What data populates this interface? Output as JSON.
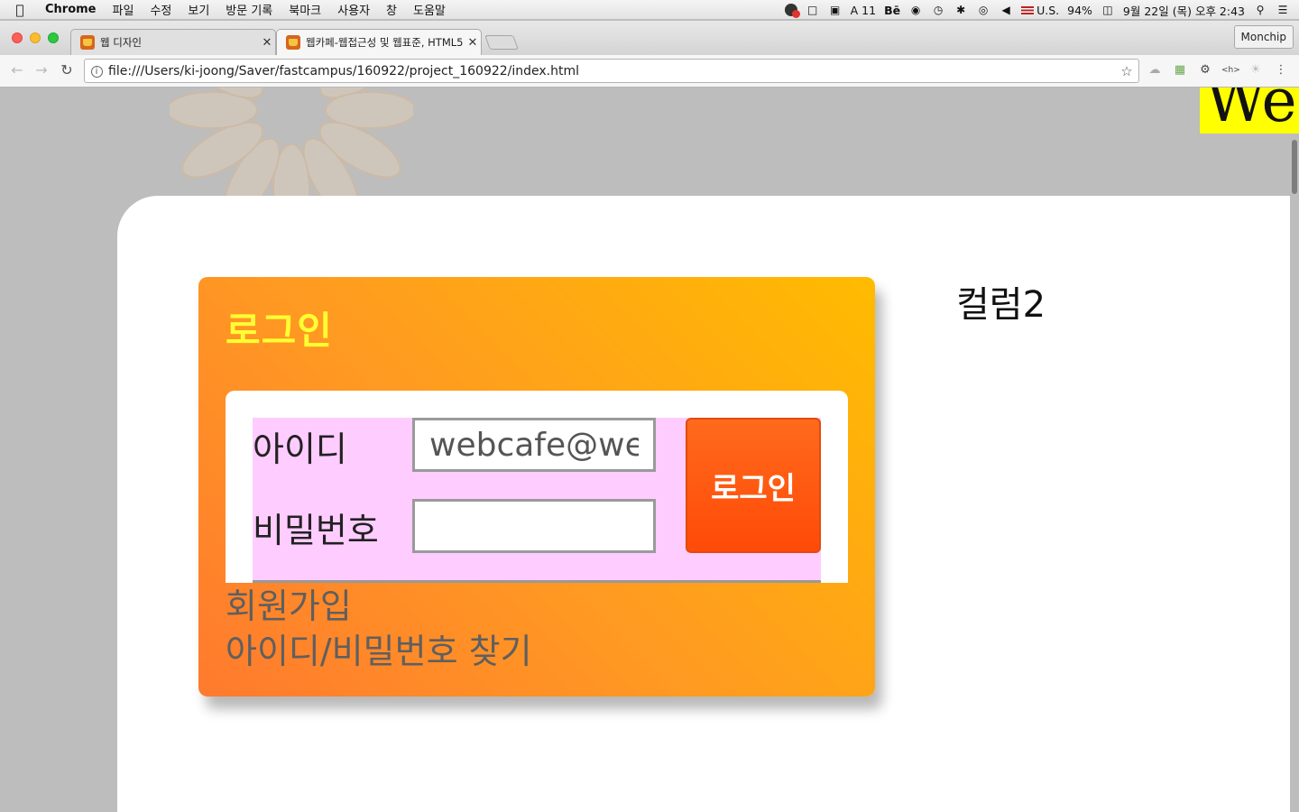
{
  "menubar": {
    "app_name": "Chrome",
    "items": [
      "파일",
      "수정",
      "보기",
      "방문 기록",
      "북마크",
      "사용자",
      "창",
      "도움말"
    ],
    "status": {
      "badge_count": "11",
      "behance": "Bē",
      "input_source": "U.S.",
      "battery": "94%",
      "datetime": "9월 22일 (목) 오후 2:43"
    }
  },
  "tabs": [
    {
      "title": "웹 디자인",
      "active": false
    },
    {
      "title": "웹카페-웹접근성 및 웹표준, HTML5",
      "active": true
    }
  ],
  "profile_name": "Monchip",
  "address_bar": {
    "url": "file:///Users/ki-joong/Saver/fastcampus/160922/project_160922/index.html"
  },
  "page": {
    "corner_logo_text": "We",
    "login": {
      "title": "로그인",
      "id_label": "아이디",
      "id_value": "webcafe@webcafe.kr",
      "password_label": "비밀번호",
      "password_value": "",
      "submit_label": "로그인",
      "signup_link": "회원가입",
      "find_link": "아이디/비밀번호 찾기"
    },
    "column2_title": "컬럼2"
  },
  "colors": {
    "login_card_start": "#ff7a2e",
    "login_card_end": "#ffbb00",
    "login_title": "#ffff33",
    "form_highlight": "#ffccff",
    "login_button": "#ff4a08",
    "corner_logo_bg": "#ffff00",
    "page_bg": "#bdbdbd"
  }
}
